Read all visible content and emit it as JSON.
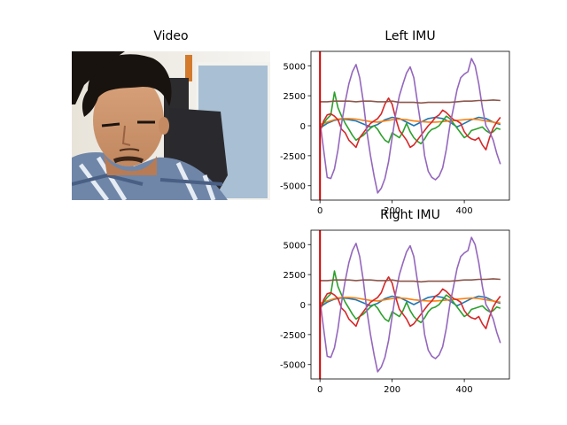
{
  "panels": {
    "video": {
      "title": "Video"
    },
    "left": {
      "title": "Left IMU"
    },
    "right": {
      "title": "Right IMU"
    }
  },
  "colors": {
    "series": [
      "#1f77b4",
      "#ff7f0e",
      "#2ca02c",
      "#d62728",
      "#9467bd",
      "#8c564b"
    ],
    "cursor": "#d00000"
  },
  "chart_data": [
    {
      "type": "line",
      "title": "Left IMU",
      "xlim": [
        -25,
        525
      ],
      "ylim": [
        -6200,
        6200
      ],
      "xticks": [
        0,
        200,
        400
      ],
      "yticks": [
        5000,
        2500,
        0,
        -2500,
        -5000
      ],
      "grid": false,
      "cursor_x": 0,
      "series": [
        {
          "x": [
            0,
            20,
            40,
            60,
            80,
            100,
            120,
            140,
            160,
            180,
            200,
            220,
            240,
            260,
            280,
            300,
            320,
            340,
            360,
            380,
            400,
            420,
            440,
            460,
            480,
            500
          ],
          "values": [
            -200,
            200,
            450,
            550,
            500,
            400,
            150,
            -100,
            100,
            500,
            700,
            600,
            300,
            0,
            300,
            600,
            700,
            600,
            300,
            -100,
            200,
            500,
            700,
            600,
            300,
            100
          ]
        },
        {
          "x": [
            0,
            20,
            40,
            60,
            80,
            100,
            120,
            140,
            160,
            180,
            200,
            220,
            240,
            260,
            280,
            300,
            320,
            340,
            360,
            380,
            400,
            420,
            440,
            460,
            480,
            500
          ],
          "values": [
            100,
            300,
            500,
            600,
            600,
            550,
            450,
            350,
            300,
            400,
            500,
            550,
            500,
            400,
            350,
            300,
            300,
            350,
            400,
            450,
            500,
            550,
            500,
            400,
            300,
            200
          ]
        },
        {
          "x": [
            0,
            10,
            20,
            30,
            40,
            50,
            60,
            70,
            80,
            90,
            100,
            110,
            120,
            130,
            140,
            150,
            160,
            170,
            180,
            190,
            200,
            210,
            220,
            230,
            240,
            250,
            260,
            270,
            280,
            290,
            300,
            310,
            320,
            330,
            340,
            350,
            360,
            370,
            380,
            390,
            400,
            410,
            420,
            430,
            440,
            450,
            460,
            470,
            480,
            490,
            500
          ],
          "values": [
            -400,
            200,
            600,
            900,
            2800,
            1500,
            800,
            200,
            -300,
            -800,
            -1200,
            -1000,
            -800,
            -500,
            -200,
            0,
            -300,
            -800,
            -1200,
            -1400,
            -600,
            -800,
            -1000,
            -500,
            200,
            -500,
            -1000,
            -1300,
            -1500,
            -1100,
            -600,
            -300,
            -200,
            0,
            400,
            800,
            600,
            200,
            -200,
            -600,
            -1000,
            -800,
            -400,
            -300,
            -200,
            -100,
            -400,
            -600,
            -500,
            -200,
            -300
          ]
        },
        {
          "x": [
            0,
            10,
            20,
            30,
            40,
            50,
            60,
            70,
            80,
            90,
            100,
            110,
            120,
            130,
            140,
            150,
            160,
            170,
            180,
            190,
            200,
            210,
            220,
            230,
            240,
            250,
            260,
            270,
            280,
            290,
            300,
            310,
            320,
            330,
            340,
            350,
            360,
            370,
            380,
            390,
            400,
            410,
            420,
            430,
            440,
            450,
            460,
            470,
            480,
            490,
            500
          ],
          "values": [
            -500,
            400,
            900,
            1000,
            800,
            500,
            -300,
            -600,
            -1200,
            -1500,
            -1800,
            -1000,
            -600,
            -200,
            200,
            400,
            600,
            1000,
            1800,
            2300,
            1800,
            600,
            -400,
            -800,
            -1200,
            -1800,
            -1600,
            -1200,
            -800,
            -400,
            0,
            300,
            700,
            900,
            1300,
            1100,
            800,
            500,
            400,
            200,
            -500,
            -900,
            -1100,
            -1200,
            -1000,
            -1600,
            -2000,
            -1000,
            -200,
            300,
            700
          ]
        },
        {
          "x": [
            0,
            10,
            20,
            30,
            40,
            50,
            60,
            70,
            80,
            90,
            100,
            110,
            120,
            130,
            140,
            150,
            160,
            170,
            180,
            190,
            200,
            210,
            220,
            230,
            240,
            250,
            260,
            270,
            280,
            290,
            300,
            310,
            320,
            330,
            340,
            350,
            360,
            370,
            380,
            390,
            400,
            410,
            420,
            430,
            440,
            450,
            460,
            470,
            480,
            490,
            500
          ],
          "values": [
            300,
            -2000,
            -4300,
            -4400,
            -3600,
            -2000,
            200,
            2000,
            3500,
            4500,
            5100,
            4000,
            2000,
            -500,
            -2500,
            -4200,
            -5600,
            -5200,
            -4400,
            -3000,
            -1000,
            1000,
            2500,
            3500,
            4400,
            4900,
            4000,
            2000,
            0,
            -2500,
            -3800,
            -4300,
            -4500,
            -4200,
            -3500,
            -2000,
            0,
            1500,
            3000,
            4000,
            4300,
            4500,
            5600,
            5000,
            3500,
            1500,
            0,
            -500,
            -1200,
            -2300,
            -3200
          ]
        },
        {
          "x": [
            0,
            20,
            40,
            60,
            80,
            100,
            120,
            140,
            160,
            180,
            200,
            220,
            240,
            260,
            280,
            300,
            320,
            340,
            360,
            380,
            400,
            420,
            440,
            460,
            480,
            500
          ],
          "values": [
            2000,
            2000,
            2050,
            2050,
            2050,
            2000,
            2050,
            2050,
            2000,
            2000,
            2050,
            1950,
            1950,
            1950,
            1900,
            1950,
            1950,
            1950,
            1950,
            2000,
            2050,
            2050,
            2100,
            2100,
            2150,
            2100
          ]
        }
      ]
    },
    {
      "type": "line",
      "title": "Right IMU",
      "xlim": [
        -25,
        525
      ],
      "ylim": [
        -6200,
        6200
      ],
      "xticks": [
        0,
        200,
        400
      ],
      "yticks": [
        5000,
        2500,
        0,
        -2500,
        -5000
      ],
      "grid": false,
      "cursor_x": 0,
      "series": [
        {
          "x": [
            0,
            20,
            40,
            60,
            80,
            100,
            120,
            140,
            160,
            180,
            200,
            220,
            240,
            260,
            280,
            300,
            320,
            340,
            360,
            380,
            400,
            420,
            440,
            460,
            480,
            500
          ],
          "values": [
            -200,
            200,
            450,
            550,
            500,
            400,
            150,
            -100,
            100,
            500,
            700,
            600,
            300,
            0,
            300,
            600,
            700,
            600,
            300,
            -100,
            200,
            500,
            700,
            600,
            300,
            100
          ]
        },
        {
          "x": [
            0,
            20,
            40,
            60,
            80,
            100,
            120,
            140,
            160,
            180,
            200,
            220,
            240,
            260,
            280,
            300,
            320,
            340,
            360,
            380,
            400,
            420,
            440,
            460,
            480,
            500
          ],
          "values": [
            100,
            300,
            500,
            600,
            600,
            550,
            450,
            350,
            300,
            400,
            500,
            550,
            500,
            400,
            350,
            300,
            300,
            350,
            400,
            450,
            500,
            550,
            500,
            400,
            300,
            200
          ]
        },
        {
          "x": [
            0,
            10,
            20,
            30,
            40,
            50,
            60,
            70,
            80,
            90,
            100,
            110,
            120,
            130,
            140,
            150,
            160,
            170,
            180,
            190,
            200,
            210,
            220,
            230,
            240,
            250,
            260,
            270,
            280,
            290,
            300,
            310,
            320,
            330,
            340,
            350,
            360,
            370,
            380,
            390,
            400,
            410,
            420,
            430,
            440,
            450,
            460,
            470,
            480,
            490,
            500
          ],
          "values": [
            -400,
            200,
            600,
            900,
            2800,
            1500,
            800,
            200,
            -300,
            -800,
            -1200,
            -1000,
            -800,
            -500,
            -200,
            0,
            -300,
            -800,
            -1200,
            -1400,
            -600,
            -800,
            -1000,
            -500,
            200,
            -500,
            -1000,
            -1300,
            -1500,
            -1100,
            -600,
            -300,
            -200,
            0,
            400,
            800,
            600,
            200,
            -200,
            -600,
            -1000,
            -800,
            -400,
            -300,
            -200,
            -100,
            -400,
            -600,
            -500,
            -200,
            -300
          ]
        },
        {
          "x": [
            0,
            10,
            20,
            30,
            40,
            50,
            60,
            70,
            80,
            90,
            100,
            110,
            120,
            130,
            140,
            150,
            160,
            170,
            180,
            190,
            200,
            210,
            220,
            230,
            240,
            250,
            260,
            270,
            280,
            290,
            300,
            310,
            320,
            330,
            340,
            350,
            360,
            370,
            380,
            390,
            400,
            410,
            420,
            430,
            440,
            450,
            460,
            470,
            480,
            490,
            500
          ],
          "values": [
            -500,
            400,
            900,
            1000,
            800,
            500,
            -300,
            -600,
            -1200,
            -1500,
            -1800,
            -1000,
            -600,
            -200,
            200,
            400,
            600,
            1000,
            1800,
            2300,
            1800,
            600,
            -400,
            -800,
            -1200,
            -1800,
            -1600,
            -1200,
            -800,
            -400,
            0,
            300,
            700,
            900,
            1300,
            1100,
            800,
            500,
            400,
            200,
            -500,
            -900,
            -1100,
            -1200,
            -1000,
            -1600,
            -2000,
            -1000,
            -200,
            300,
            700
          ]
        },
        {
          "x": [
            0,
            10,
            20,
            30,
            40,
            50,
            60,
            70,
            80,
            90,
            100,
            110,
            120,
            130,
            140,
            150,
            160,
            170,
            180,
            190,
            200,
            210,
            220,
            230,
            240,
            250,
            260,
            270,
            280,
            290,
            300,
            310,
            320,
            330,
            340,
            350,
            360,
            370,
            380,
            390,
            400,
            410,
            420,
            430,
            440,
            450,
            460,
            470,
            480,
            490,
            500
          ],
          "values": [
            300,
            -2000,
            -4300,
            -4400,
            -3600,
            -2000,
            200,
            2000,
            3500,
            4500,
            5100,
            4000,
            2000,
            -500,
            -2500,
            -4200,
            -5600,
            -5200,
            -4400,
            -3000,
            -1000,
            1000,
            2500,
            3500,
            4400,
            4900,
            4000,
            2000,
            0,
            -2500,
            -3800,
            -4300,
            -4500,
            -4200,
            -3500,
            -2000,
            0,
            1500,
            3000,
            4000,
            4300,
            4500,
            5600,
            5000,
            3500,
            1500,
            0,
            -500,
            -1200,
            -2300,
            -3200
          ]
        },
        {
          "x": [
            0,
            20,
            40,
            60,
            80,
            100,
            120,
            140,
            160,
            180,
            200,
            220,
            240,
            260,
            280,
            300,
            320,
            340,
            360,
            380,
            400,
            420,
            440,
            460,
            480,
            500
          ],
          "values": [
            2000,
            2000,
            2050,
            2050,
            2050,
            2000,
            2050,
            2050,
            2000,
            2000,
            2050,
            1950,
            1950,
            1950,
            1900,
            1950,
            1950,
            1950,
            1950,
            2000,
            2050,
            2050,
            2100,
            2100,
            2150,
            2100
          ]
        }
      ]
    }
  ]
}
